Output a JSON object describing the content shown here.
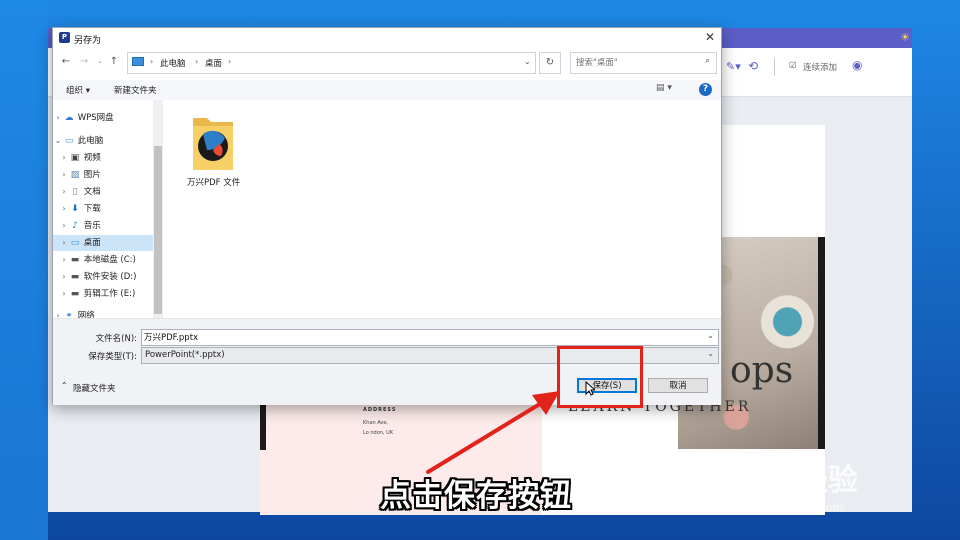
{
  "dialog": {
    "title": "另存为",
    "app_icon": "wps-pdf-icon",
    "breadcrumb": [
      "此电脑",
      "桌面"
    ],
    "search_placeholder": "搜索\"桌面\"",
    "toolbar": {
      "organize": "组织 ▾",
      "new_folder": "新建文件夹"
    },
    "sidebar": [
      {
        "label": "WPS网盘",
        "icon": "cloud-icon"
      },
      {
        "label": "此电脑",
        "icon": "computer-icon"
      },
      {
        "label": "视频",
        "icon": "video-icon"
      },
      {
        "label": "图片",
        "icon": "picture-icon"
      },
      {
        "label": "文档",
        "icon": "document-icon"
      },
      {
        "label": "下载",
        "icon": "download-icon"
      },
      {
        "label": "音乐",
        "icon": "music-icon"
      },
      {
        "label": "桌面",
        "icon": "desktop-icon"
      },
      {
        "label": "本地磁盘 (C:)",
        "icon": "drive-icon"
      },
      {
        "label": "软件安装 (D:)",
        "icon": "drive-icon"
      },
      {
        "label": "剪辑工作 (E:)",
        "icon": "drive-icon"
      },
      {
        "label": "网络",
        "icon": "network-icon"
      }
    ],
    "files": [
      {
        "name": "万兴PDF 文件",
        "icon": "folder-icon"
      }
    ],
    "filename_label": "文件名(N):",
    "filename_value": "万兴PDF.pptx",
    "filetype_label": "保存类型(T):",
    "filetype_value": "PowerPoint(*.pptx)",
    "hide_folders": "隐藏文件夹",
    "save_button": "保存(S)",
    "cancel_button": "取消"
  },
  "background_app": {
    "continuous_add": "连续添加",
    "doc": {
      "big_text": "ops",
      "tagline": "LEARN TOGETHER",
      "address_title": "ADDRESS",
      "address_lines": [
        "Khan Ave,",
        "Lo ndon, UK"
      ]
    }
  },
  "caption": "点击保存按钮",
  "watermark": {
    "logo": "Bai 经验",
    "url": "jingyan.baidu.com"
  },
  "colors": {
    "highlight_red": "#e2231a",
    "selection_blue": "#cce4f7",
    "accent": "#0078d7"
  }
}
